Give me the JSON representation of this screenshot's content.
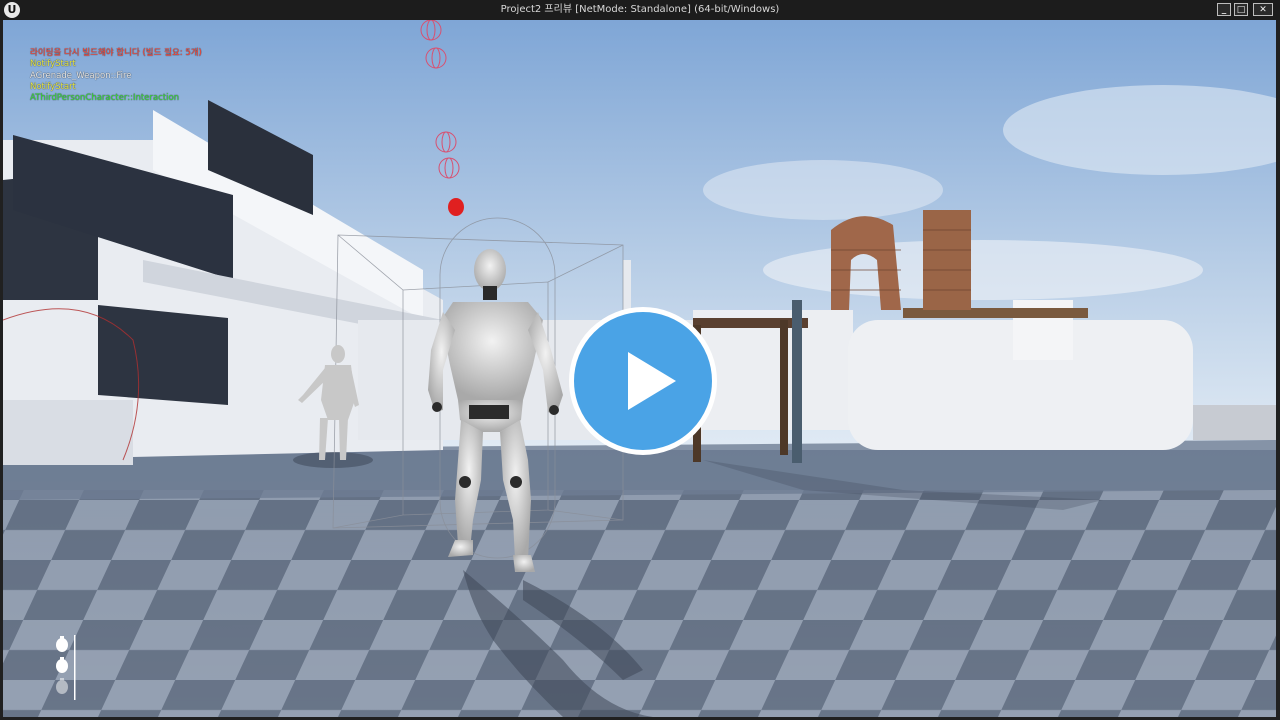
{
  "window": {
    "logo_text": "U",
    "title": "Project2 프리뷰 [NetMode: Standalone]  (64-bit/Windows)",
    "minimize_glyph": "_",
    "maximize_glyph": "□",
    "close_glyph": "✕"
  },
  "debug_messages": [
    {
      "text": "라이팅을 다시 빌드해야 합니다 (빌드 필요: 5개)",
      "color": "#ff4a3a"
    },
    {
      "text": "NotifyStart",
      "color": "#e6e64a"
    },
    {
      "text": "AGrenade_Weapon::Fire",
      "color": "#e8e8e8"
    },
    {
      "text": "NotifyStart",
      "color": "#e6e64a"
    },
    {
      "text": "AThirdPersonCharacter::Interaction",
      "color": "#3ddc3d"
    }
  ],
  "overlay": {
    "play_button_icon": "play-icon",
    "accent_color": "#4aa3e6"
  },
  "hud": {
    "ammo_icon": "grenade-icon",
    "grenade_count": 3
  }
}
